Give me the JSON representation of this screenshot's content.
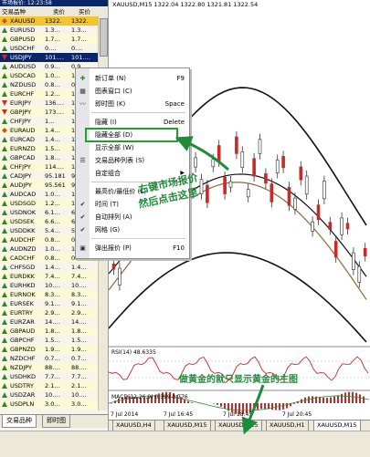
{
  "market_watch": {
    "title": "市场报价: 12:23:58",
    "columns": {
      "symbol": "交易品种",
      "bid": "卖价",
      "ask": "买价"
    },
    "rows": [
      {
        "symbol": "XAUUSD",
        "bid": "1322.",
        "ask": "1322.",
        "dir": "dia",
        "selected": true
      },
      {
        "symbol": "EURUSD",
        "bid": "1.3…",
        "ask": "1.3…",
        "dir": "up"
      },
      {
        "symbol": "GBPUSD",
        "bid": "1.7…",
        "ask": "1.7…",
        "dir": "up"
      },
      {
        "symbol": "USDCHF",
        "bid": "0.…",
        "ask": "0.…",
        "dir": "up"
      },
      {
        "symbol": "USDJPY",
        "bid": "101.…",
        "ask": "101.…",
        "dir": "dn",
        "selected2": true
      },
      {
        "symbol": "AUDUSD",
        "bid": "0.9…",
        "ask": "0.9…",
        "dir": "up"
      },
      {
        "symbol": "USDCAD",
        "bid": "1.0…",
        "ask": "1.0…",
        "dir": "up"
      },
      {
        "symbol": "NZDUSD",
        "bid": "0.8…",
        "ask": "0.8…",
        "dir": "up"
      },
      {
        "symbol": "EURCHF",
        "bid": "1.2…",
        "ask": "1.2…",
        "dir": "up"
      },
      {
        "symbol": "EURJPY",
        "bid": "136.…",
        "ask": "136.…",
        "dir": "dn"
      },
      {
        "symbol": "GBPJPY",
        "bid": "173.…",
        "ask": "173.…",
        "dir": "dn"
      },
      {
        "symbol": "CHFJPY",
        "bid": "1…",
        "ask": "1…",
        "dir": "up"
      },
      {
        "symbol": "EURAUD",
        "bid": "1.4…",
        "ask": "1.4…",
        "dir": "dia"
      },
      {
        "symbol": "EURCAD",
        "bid": "1.4…",
        "ask": "1.4…",
        "dir": "up"
      },
      {
        "symbol": "EURNZD",
        "bid": "1.5…",
        "ask": "1.5…",
        "dir": "up"
      },
      {
        "symbol": "GBPCAD",
        "bid": "1.8…",
        "ask": "1.8…",
        "dir": "up"
      },
      {
        "symbol": "CHFJPY",
        "bid": "114.…",
        "ask": "114.…",
        "dir": "up"
      },
      {
        "symbol": "CADJPY",
        "bid": "95.181",
        "ask": "95.215",
        "dir": "up"
      },
      {
        "symbol": "AUDJPY",
        "bid": "95.561",
        "ask": "95.591",
        "dir": "up"
      },
      {
        "symbol": "AUDCAD",
        "bid": "1.0…",
        "ask": "1.0…",
        "dir": "up"
      },
      {
        "symbol": "USDSGD",
        "bid": "1.2…",
        "ask": "1.2…",
        "dir": "up"
      },
      {
        "symbol": "USDNOK",
        "bid": "6.1…",
        "ask": "6.1…",
        "dir": "up"
      },
      {
        "symbol": "USDSEK",
        "bid": "6.6…",
        "ask": "6.6…",
        "dir": "up"
      },
      {
        "symbol": "USDDKK",
        "bid": "5.4…",
        "ask": "5.4…",
        "dir": "up"
      },
      {
        "symbol": "AUDCHF",
        "bid": "0.8…",
        "ask": "0.8…",
        "dir": "up"
      },
      {
        "symbol": "AUDNZD",
        "bid": "1.0…",
        "ask": "1.0…",
        "dir": "up"
      },
      {
        "symbol": "CADCHF",
        "bid": "0.8…",
        "ask": "0.8…",
        "dir": "up"
      },
      {
        "symbol": "CHFSGD",
        "bid": "1.4…",
        "ask": "1.4…",
        "dir": "up"
      },
      {
        "symbol": "EURDKK",
        "bid": "7.4…",
        "ask": "7.4…",
        "dir": "up"
      },
      {
        "symbol": "EURHKD",
        "bid": "10.…",
        "ask": "10.…",
        "dir": "up"
      },
      {
        "symbol": "EURNOK",
        "bid": "8.3…",
        "ask": "8.3…",
        "dir": "up"
      },
      {
        "symbol": "EURSEK",
        "bid": "9.1…",
        "ask": "9.1…",
        "dir": "up"
      },
      {
        "symbol": "EURTRY",
        "bid": "2.9…",
        "ask": "2.9…",
        "dir": "up"
      },
      {
        "symbol": "EURZAR",
        "bid": "14.…",
        "ask": "14.…",
        "dir": "up"
      },
      {
        "symbol": "GBPAUD",
        "bid": "1.8…",
        "ask": "1.8…",
        "dir": "up"
      },
      {
        "symbol": "GBPCHF",
        "bid": "1.5…",
        "ask": "1.5…",
        "dir": "up"
      },
      {
        "symbol": "GBPNZD",
        "bid": "1.9…",
        "ask": "1.9…",
        "dir": "up"
      },
      {
        "symbol": "NZDCHF",
        "bid": "0.7…",
        "ask": "0.7…",
        "dir": "up"
      },
      {
        "symbol": "NZDJPY",
        "bid": "88.…",
        "ask": "88.…",
        "dir": "up"
      },
      {
        "symbol": "USDHKD",
        "bid": "7.7…",
        "ask": "7.7…",
        "dir": "up"
      },
      {
        "symbol": "USDTRY",
        "bid": "2.1…",
        "ask": "2.1…",
        "dir": "up"
      },
      {
        "symbol": "USDZAR",
        "bid": "10.…",
        "ask": "10.…",
        "dir": "up"
      },
      {
        "symbol": "USDPLN",
        "bid": "3.0…",
        "ask": "3.0…",
        "dir": "up"
      }
    ],
    "tabs": [
      "交易品种",
      "即时图"
    ]
  },
  "context_menu": {
    "items": [
      {
        "label": "新订单 (N)",
        "shortcut": "F9",
        "icon": "new-order-icon"
      },
      {
        "label": "图表窗口 (C)",
        "shortcut": "",
        "icon": "chart-window-icon"
      },
      {
        "label": "即时图 (K)",
        "shortcut": "Space",
        "icon": "tick-chart-icon"
      },
      {
        "sep": true
      },
      {
        "label": "隐藏 (I)",
        "shortcut": "Delete"
      },
      {
        "label": "隐藏全部 (D)",
        "shortcut": "",
        "highlighted": true
      },
      {
        "label": "显示全部 (W)",
        "shortcut": ""
      },
      {
        "label": "交易品种列表 (S)",
        "shortcut": "",
        "icon": "symbols-icon"
      },
      {
        "label": "自定组合",
        "shortcut": "",
        "submenu": true
      },
      {
        "sep": true
      },
      {
        "label": "最高价/最低价 (L)",
        "shortcut": ""
      },
      {
        "label": "时间 (T)",
        "shortcut": "",
        "checked": true
      },
      {
        "label": "自动排列 (A)",
        "shortcut": "",
        "checked": true
      },
      {
        "label": "网格 (G)",
        "shortcut": "",
        "checked": true
      },
      {
        "sep": true
      },
      {
        "label": "弹出报价 (P)",
        "shortcut": "F10",
        "icon": "popup-icon"
      }
    ]
  },
  "chart": {
    "title": "XAUUSD,M15  1322.04 1322.80 1321.81 1322.54",
    "rsi_label": "RSI(14) 48.6335",
    "macd_label": "MACD(12,26,9) 0.399 0.776",
    "time_labels": [
      "7 Jul 2014",
      "7 Jul 16:45",
      "7 Jul 18:45",
      "7 Jul 20:45"
    ],
    "tabs": [
      "XAUUSD,H4",
      "XAUUSD,M15",
      "XAUUSD,M15",
      "XAUUSD,H1",
      "XAUUSD,M15"
    ],
    "active_tab": 4
  },
  "annotations": {
    "right_click": "右键市场报价",
    "then_click": "然后点击这里",
    "gold_note": "做黄金的就只显示黄金的主图"
  },
  "colors": {
    "bull": "#2a8a2a",
    "bear": "#c82a2a",
    "annotation": "#1f8a3a",
    "title_bar": "#0a246a"
  }
}
